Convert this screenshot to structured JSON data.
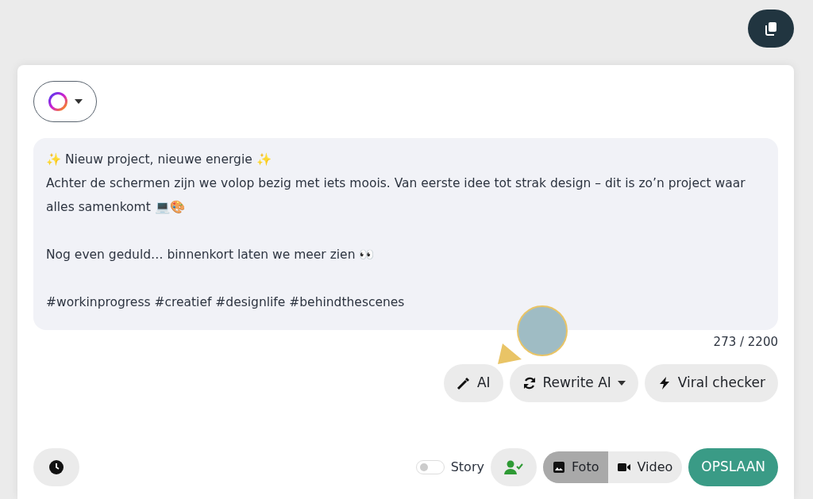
{
  "post": {
    "text": "✨ Nieuw project, nieuwe energie ✨\nAchter de schermen zijn we volop bezig met iets moois. Van eerste idee tot strak design – dit is zo’n project waar alles samenkomt 💻🎨\n\nNog even geduld… binnenkort laten we meer zien 👀\n\n#workinprogress #creatief #designlife #behindthescenes",
    "counter": "273 / 2200"
  },
  "ai_buttons": [
    {
      "kind": "ai",
      "label": "AI"
    },
    {
      "kind": "rewrite",
      "label": "Rewrite AI"
    },
    {
      "kind": "viral",
      "label": "Viral checker"
    }
  ],
  "story": {
    "label": "Story",
    "on": false
  },
  "media_types": [
    {
      "kind": "photo",
      "label": "Foto",
      "selected": true
    },
    {
      "kind": "video",
      "label": "Video",
      "selected": false
    }
  ],
  "save_button": {
    "label": "OPSLAAN"
  }
}
